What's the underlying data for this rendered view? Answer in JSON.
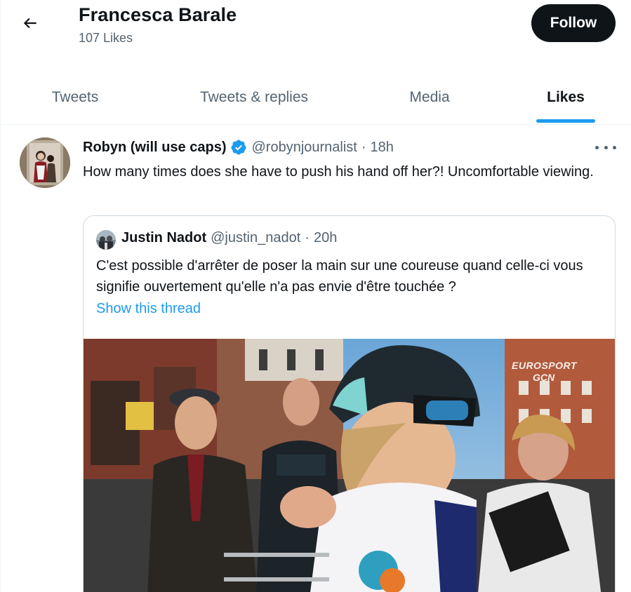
{
  "header": {
    "profile_name": "Francesca Barale",
    "likes_count": "107 Likes",
    "follow_label": "Follow",
    "back_icon": "arrow-left-icon"
  },
  "tabs": [
    {
      "label": "Tweets",
      "active": false
    },
    {
      "label": "Tweets & replies",
      "active": false
    },
    {
      "label": "Media",
      "active": false
    },
    {
      "label": "Likes",
      "active": true
    }
  ],
  "tweet": {
    "author_name": "Robyn (will use caps)",
    "handle": "@robynjournalist",
    "separator": "·",
    "time": "18h",
    "verified": true,
    "text": "How many times does she have to push his hand off her?! Uncomfortable viewing.",
    "more_icon": "more-horizontal-icon",
    "quoted": {
      "author_name": "Justin Nadot",
      "handle": "@justin_nadot",
      "separator": "·",
      "time": "20h",
      "text": "C'est possible d'arrêter de poser la main sur une coureuse quand celle-ci vous signifie ouvertement qu'elle n'a pas envie d'être touchée ?",
      "thread_link": "Show this thread",
      "media_watermark_line1": "EUROSPORT",
      "media_watermark_line2": "GCN"
    }
  },
  "colors": {
    "accent": "#1d9bf0",
    "text_primary": "#0f1419",
    "text_secondary": "#536471",
    "follow_bg": "#0f1419",
    "border": "#cfd9de"
  }
}
